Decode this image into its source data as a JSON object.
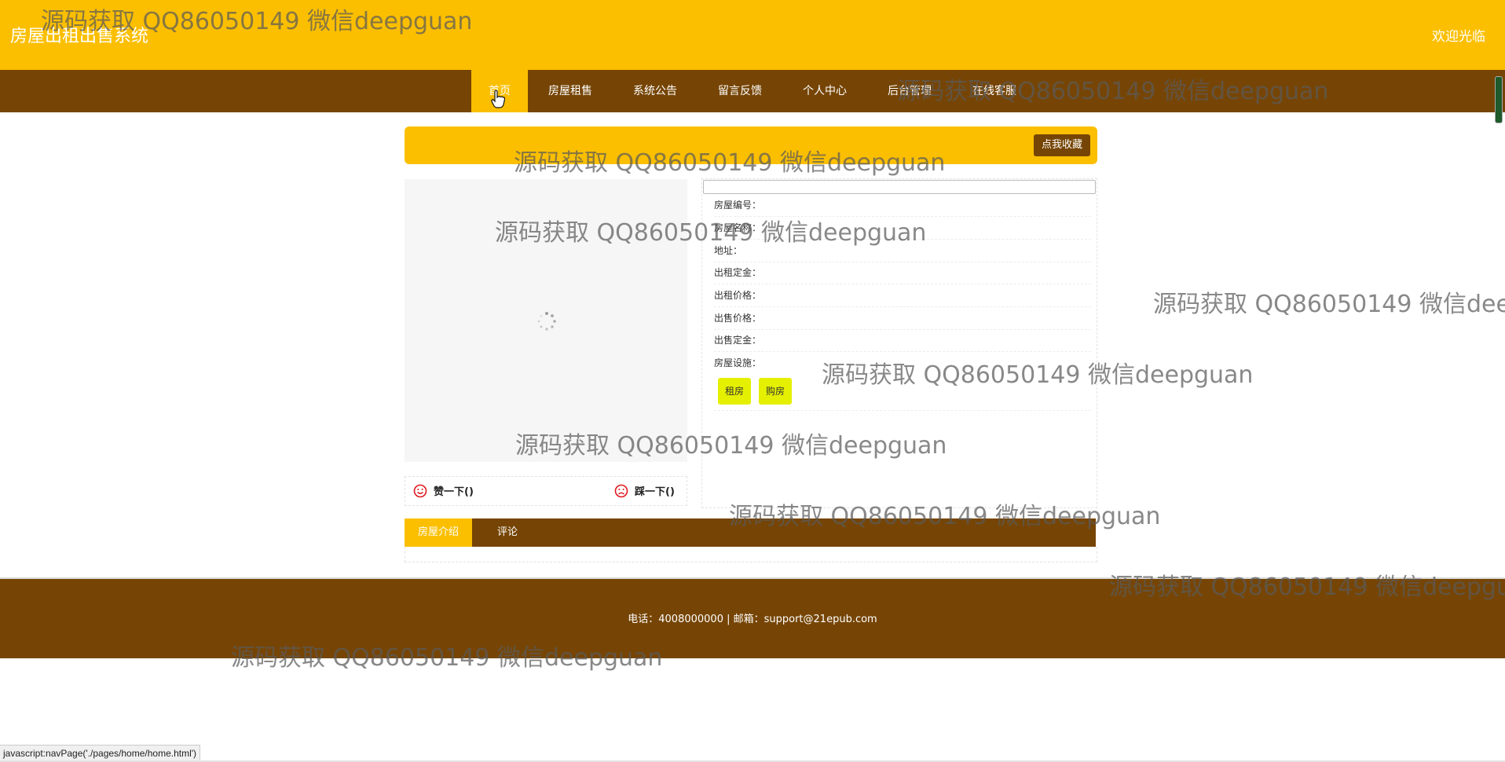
{
  "header": {
    "site_title": "房屋出租出售系统",
    "welcome": "欢迎光临"
  },
  "nav": {
    "items": [
      {
        "label": "首页",
        "active": true
      },
      {
        "label": "房屋租售"
      },
      {
        "label": "系统公告"
      },
      {
        "label": "留言反馈"
      },
      {
        "label": "个人中心"
      },
      {
        "label": "后台管理"
      },
      {
        "label": "在线客服"
      }
    ]
  },
  "notice": {
    "favorite_button": "点我收藏"
  },
  "detail": {
    "fields": [
      "房屋编号：",
      "房屋名称：",
      "地址：",
      "出租定金：",
      "出租价格：",
      "出售价格：",
      "出售定金：",
      "房屋设施："
    ],
    "rent_button": "租房",
    "buy_button": "购房"
  },
  "votes": {
    "like": "赞一下()",
    "dislike": "踩一下()"
  },
  "tabs": [
    {
      "label": "房屋介绍",
      "active": true
    },
    {
      "label": "评论"
    }
  ],
  "footer": {
    "contact": "电话：4008000000 | 邮箱：support@21epub.com"
  },
  "status_bar": {
    "url": "javascript:navPage('./pages/home/home.html')"
  },
  "watermark": {
    "text": "源码获取 QQ86050149 微信deepguan"
  },
  "colors": {
    "primary_yellow": "#fbbf00",
    "brown": "#764505",
    "button_yellow": "#e5f000",
    "vote_icon_red": "#e0171e"
  }
}
